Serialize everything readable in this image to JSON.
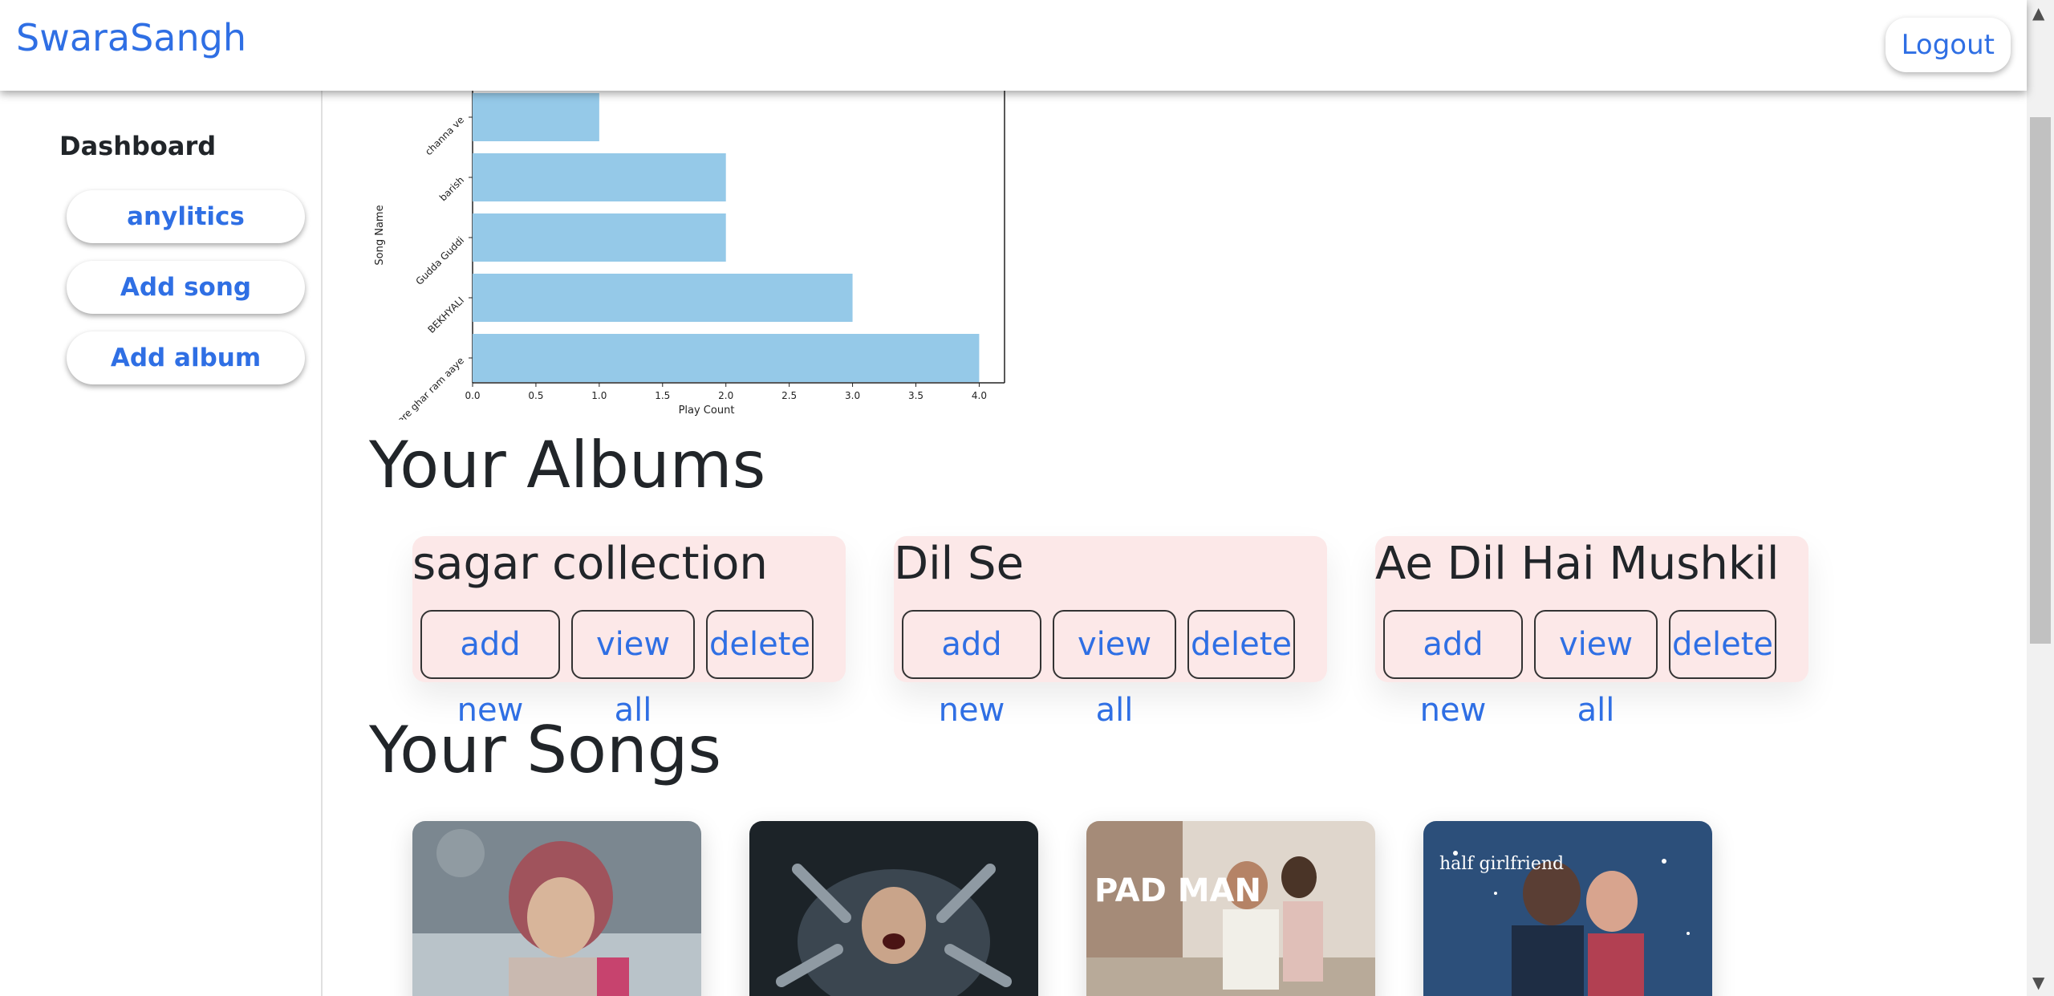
{
  "brand": "SwaraSangh",
  "logout_label": "Logout",
  "sidebar": {
    "title": "Dashboard",
    "items": [
      {
        "label": "anylitics"
      },
      {
        "label": "Add song"
      },
      {
        "label": "Add album"
      }
    ]
  },
  "chart_data": {
    "type": "bar",
    "orientation": "horizontal",
    "categories": [
      "Mere ghar ram aaye",
      "BEKHYALI",
      "Gudda Guddi",
      "barish",
      "channa ve"
    ],
    "values": [
      4,
      3,
      2,
      2,
      1
    ],
    "xlabel": "Play Count",
    "ylabel": "Song Name",
    "xticks": [
      "0.0",
      "0.5",
      "1.0",
      "1.5",
      "2.0",
      "2.5",
      "3.0",
      "3.5",
      "4.0"
    ],
    "xlim": [
      0,
      4.2
    ],
    "bar_color": "#95c9e8"
  },
  "albums_heading": "Your Albums",
  "albums": [
    {
      "title": "sagar collection",
      "add": "add new",
      "view": "view all",
      "delete": "delete"
    },
    {
      "title": "Dil Se",
      "add": "add new",
      "view": "view all",
      "delete": "delete"
    },
    {
      "title": "Ae Dil Hai Mushkil",
      "add": "add new",
      "view": "view all",
      "delete": "delete"
    }
  ],
  "songs_heading": "Your Songs",
  "songs": [
    {
      "art": "girl-in-snow-poster"
    },
    {
      "art": "horror-hands-poster"
    },
    {
      "art": "padman-poster",
      "label": "PAD MAN"
    },
    {
      "art": "half-girlfriend-poster",
      "label": "half girlfriend"
    }
  ],
  "colors": {
    "accent": "#2f6fe4",
    "album_bg": "#fce8e8",
    "bar": "#95c9e8"
  }
}
